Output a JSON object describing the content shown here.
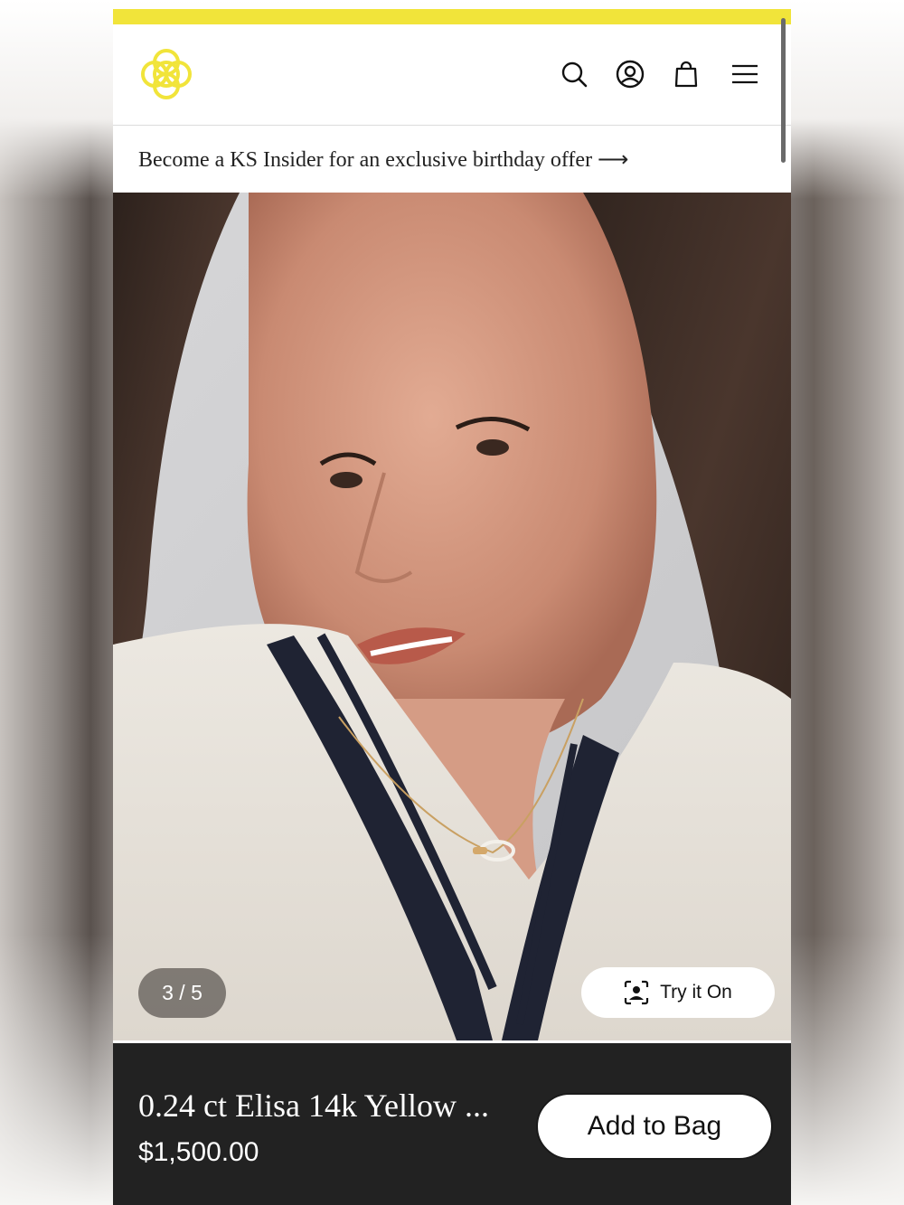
{
  "colors": {
    "accent_yellow": "#f1e43a",
    "bottom_bar": "#222222"
  },
  "header": {
    "logo_icon": "ks-flower-logo-icon",
    "icons": [
      "search-icon",
      "account-icon",
      "bag-icon",
      "menu-icon"
    ]
  },
  "promo": {
    "text": "Become a KS Insider for an exclusive birthday offer ⟶"
  },
  "gallery": {
    "counter": "3 / 5",
    "try_on_label": "Try it On",
    "current_index": 3,
    "total": 5
  },
  "product": {
    "name": "0.24 ct Elisa 14k Yellow ...",
    "price": "$1,500.00",
    "add_label": "Add to Bag"
  }
}
